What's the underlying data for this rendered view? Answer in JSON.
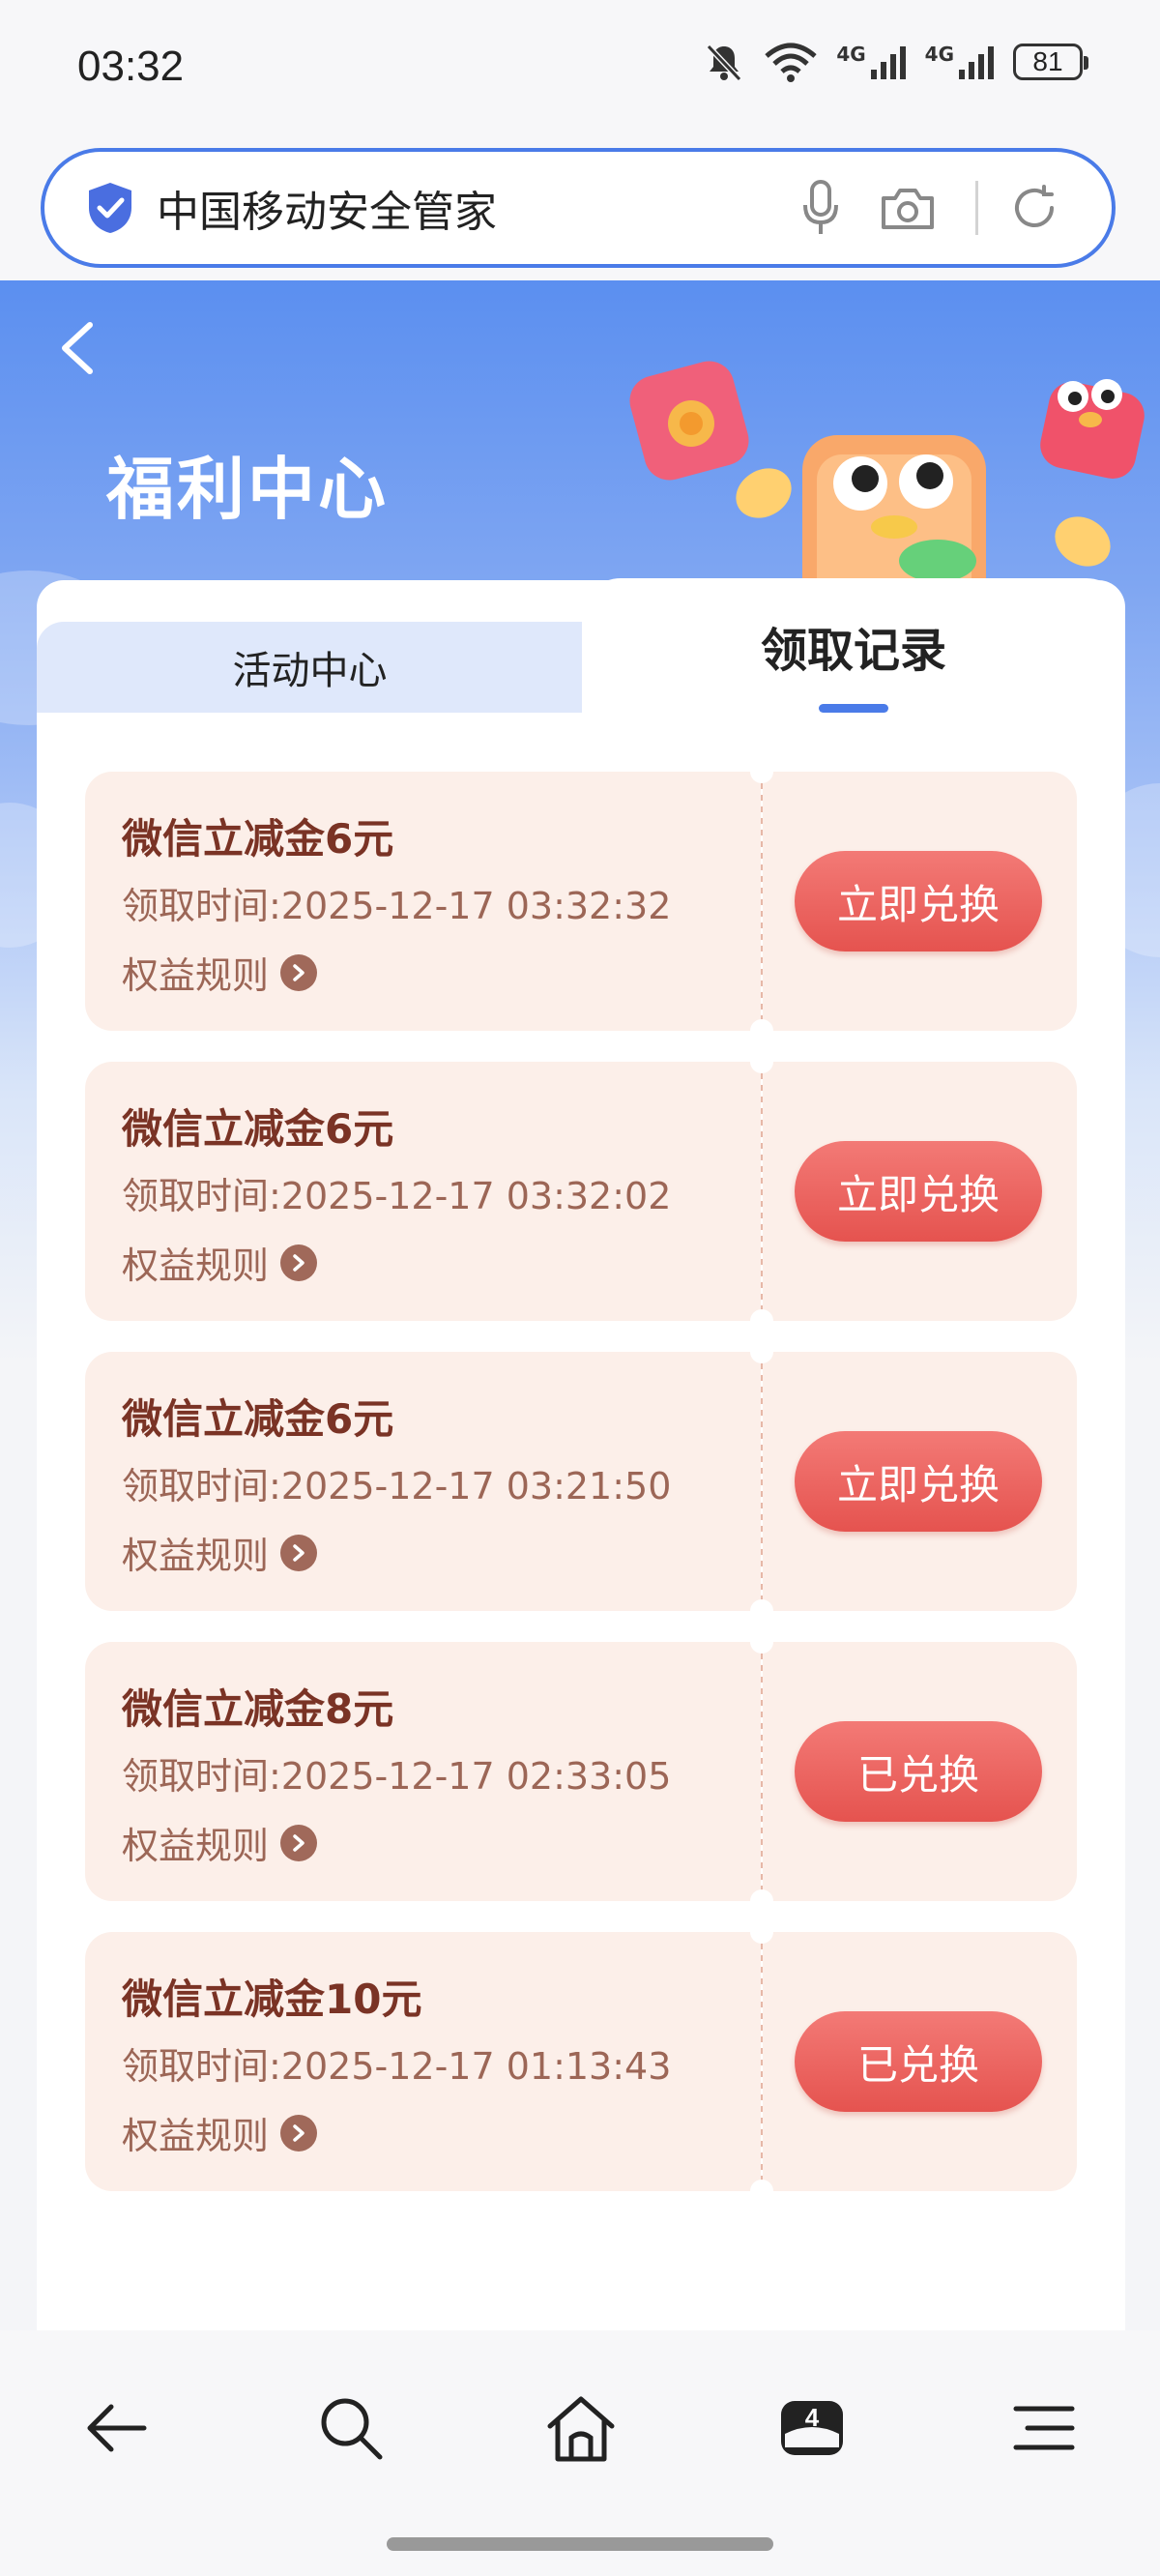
{
  "status_bar": {
    "time": "03:32",
    "battery": "81",
    "net1": "4G",
    "net2": "4G"
  },
  "search": {
    "query": "中国移动安全管家"
  },
  "page": {
    "title": "福利中心"
  },
  "tabs": [
    {
      "label": "活动中心"
    },
    {
      "label": "领取记录"
    }
  ],
  "records": [
    {
      "title": "微信立减金6元",
      "time": "领取时间:2025-12-17 03:32:32",
      "rule": "权益规则",
      "button": "立即兑换"
    },
    {
      "title": "微信立减金6元",
      "time": "领取时间:2025-12-17 03:32:02",
      "rule": "权益规则",
      "button": "立即兑换"
    },
    {
      "title": "微信立减金6元",
      "time": "领取时间:2025-12-17 03:21:50",
      "rule": "权益规则",
      "button": "立即兑换"
    },
    {
      "title": "微信立减金8元",
      "time": "领取时间:2025-12-17 02:33:05",
      "rule": "权益规则",
      "button": "已兑换"
    },
    {
      "title": "微信立减金10元",
      "time": "领取时间:2025-12-17 01:13:43",
      "rule": "权益规则",
      "button": "已兑换"
    }
  ],
  "bottom_nav": {
    "items": [
      "back-arrow-icon",
      "search-icon",
      "home-icon",
      "tabs-icon",
      "menu-icon"
    ],
    "tab_count": "4"
  },
  "colors": {
    "accent": "#4a7be8",
    "button": "#e5534f",
    "coupon_bg": "#fcefe9",
    "coupon_title": "#7a3325"
  }
}
